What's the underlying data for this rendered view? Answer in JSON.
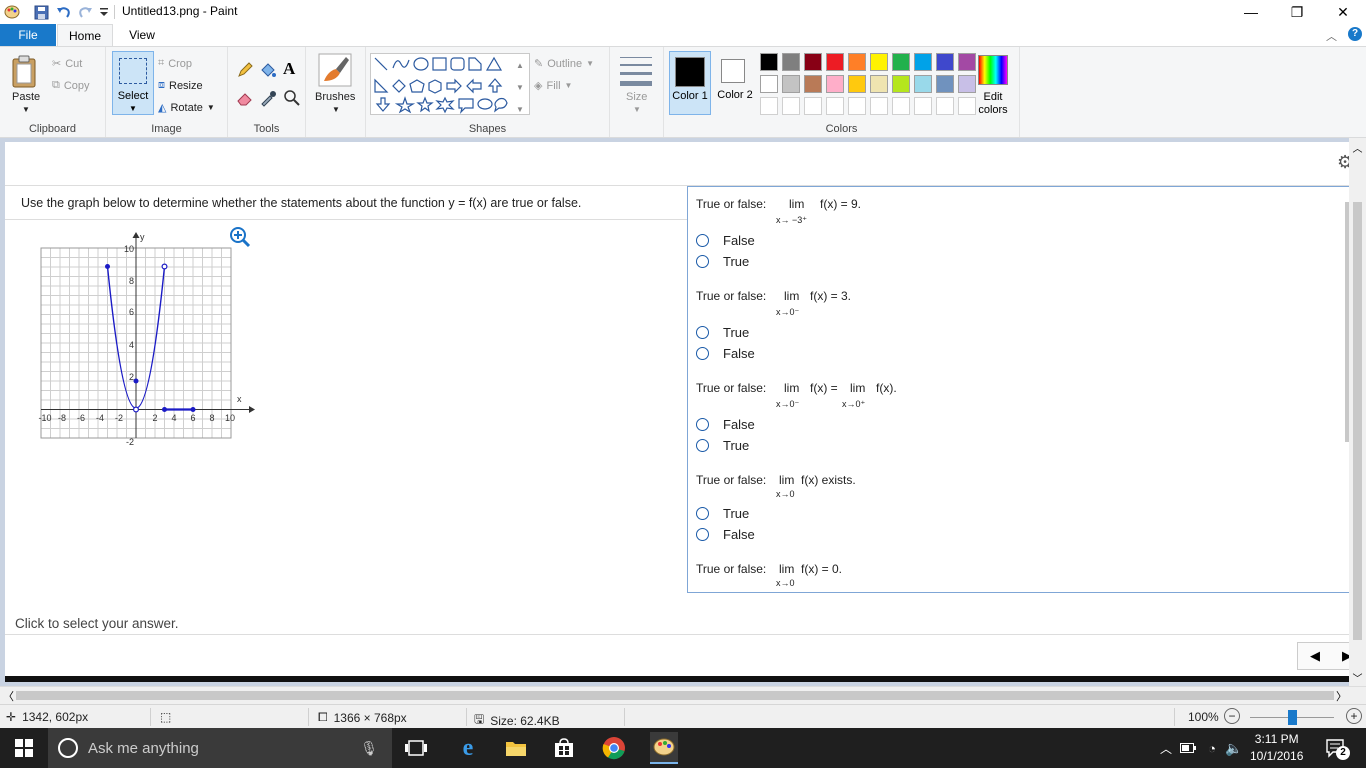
{
  "window": {
    "title": "Untitled13.png - Paint",
    "minimize": "—",
    "restore": "❐",
    "close": "✕"
  },
  "tabs": {
    "file": "File",
    "home": "Home",
    "view": "View"
  },
  "ribbon": {
    "clipboard": {
      "label": "Clipboard",
      "paste": "Paste",
      "cut": "Cut",
      "copy": "Copy"
    },
    "image": {
      "label": "Image",
      "select": "Select",
      "crop": "Crop",
      "resize": "Resize",
      "rotate": "Rotate"
    },
    "tools": {
      "label": "Tools"
    },
    "brushes": {
      "label": "Brushes"
    },
    "shapes": {
      "label": "Shapes",
      "outline": "Outline",
      "fill": "Fill"
    },
    "size": {
      "label": "Size"
    },
    "colors": {
      "label": "Colors",
      "color1": "Color 1",
      "color2": "Color 2",
      "edit": "Edit colors",
      "row1": [
        "#000000",
        "#7f7f7f",
        "#880015",
        "#ed1c24",
        "#ff7f27",
        "#fff200",
        "#22b14c",
        "#00a2e8",
        "#3f48cc",
        "#a349a4"
      ],
      "row2": [
        "#ffffff",
        "#c3c3c3",
        "#b97a57",
        "#ffaec9",
        "#ffc90e",
        "#efe4b0",
        "#b5e61d",
        "#99d9ea",
        "#7092be",
        "#c8bfe7"
      ]
    }
  },
  "doc": {
    "instruction": "Use the graph below to determine whether the statements about the function y = f(x) are true or false.",
    "footer": "Click to select your answer.",
    "graph": {
      "ylabel": "y",
      "xlabel": "x",
      "yticks": [
        "10",
        "8",
        "6",
        "4",
        "2",
        "-2"
      ],
      "xticks": [
        "-10",
        "-8",
        "-6",
        "-4",
        "-2",
        "2",
        "4",
        "6",
        "8",
        "10"
      ]
    },
    "questions": [
      {
        "prefix": "True or false:",
        "lim": "lim",
        "expr": "f(x) = 9.",
        "sub": "x→ −3⁺",
        "options": [
          "False",
          "True"
        ]
      },
      {
        "prefix": "True or false:",
        "lim": "lim",
        "expr": "f(x) = 3.",
        "sub": "x→0⁻",
        "options": [
          "True",
          "False"
        ]
      },
      {
        "prefix": "True or false:",
        "lim": "lim",
        "expr": "f(x) =",
        "lim2": "lim",
        "expr2": "f(x).",
        "sub": "x→0⁻",
        "sub2": "x→0⁺",
        "options": [
          "False",
          "True"
        ]
      },
      {
        "prefix": "True or false:",
        "lim": "lim",
        "expr": "f(x) exists.",
        "sub": "x→0",
        "options": [
          "True",
          "False"
        ]
      },
      {
        "prefix": "True or false:",
        "lim": "lim",
        "expr": "f(x) = 0.",
        "sub": "x→0",
        "options": []
      }
    ]
  },
  "status": {
    "cursor": "1342, 602px",
    "dimensions": "1366 × 768px",
    "size": "Size: 62.4KB",
    "zoom": "100%"
  },
  "taskbar": {
    "search_placeholder": "Ask me anything",
    "time": "3:11 PM",
    "date": "10/1/2016",
    "notifications": "2"
  }
}
